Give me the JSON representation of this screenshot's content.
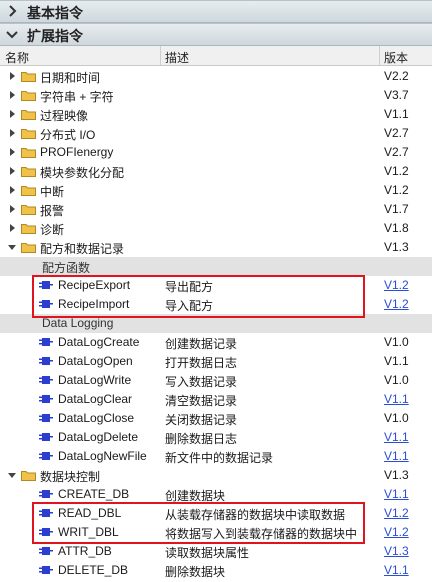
{
  "sections": {
    "basic": {
      "title": "基本指令"
    },
    "extended": {
      "title": "扩展指令"
    }
  },
  "columns": {
    "name": "名称",
    "desc": "描述",
    "version": "版本"
  },
  "folders": [
    {
      "name": "日期和时间",
      "version": "V2.2",
      "expanded": false
    },
    {
      "name": "字符串 + 字符",
      "version": "V3.7",
      "expanded": false
    },
    {
      "name": "过程映像",
      "version": "V1.1",
      "expanded": false
    },
    {
      "name": "分布式 I/O",
      "version": "V2.7",
      "expanded": false
    },
    {
      "name": "PROFIenergy",
      "version": "V2.7",
      "expanded": false
    },
    {
      "name": "模块参数化分配",
      "version": "V1.2",
      "expanded": false
    },
    {
      "name": "中断",
      "version": "V1.2",
      "expanded": false
    },
    {
      "name": "报警",
      "version": "V1.7",
      "expanded": false
    },
    {
      "name": "诊断",
      "version": "V1.8",
      "expanded": false
    },
    {
      "name": "配方和数据记录",
      "version": "V1.3",
      "expanded": true
    }
  ],
  "recipe": {
    "group_label": "配方函数",
    "items": [
      {
        "name": "RecipeExport",
        "desc": "导出配方",
        "version": "V1.2",
        "link": true
      },
      {
        "name": "RecipeImport",
        "desc": "导入配方",
        "version": "V1.2",
        "link": true
      }
    ]
  },
  "datalog": {
    "group_label": "Data Logging",
    "items": [
      {
        "name": "DataLogCreate",
        "desc": "创建数据记录",
        "version": "V1.0",
        "link": false
      },
      {
        "name": "DataLogOpen",
        "desc": "打开数据日志",
        "version": "V1.1",
        "link": false
      },
      {
        "name": "DataLogWrite",
        "desc": "写入数据记录",
        "version": "V1.0",
        "link": false
      },
      {
        "name": "DataLogClear",
        "desc": "清空数据记录",
        "version": "V1.1",
        "link": true
      },
      {
        "name": "DataLogClose",
        "desc": "关闭数据记录",
        "version": "V1.0",
        "link": false
      },
      {
        "name": "DataLogDelete",
        "desc": "删除数据日志",
        "version": "V1.1",
        "link": true
      },
      {
        "name": "DataLogNewFile",
        "desc": "新文件中的数据记录",
        "version": "V1.1",
        "link": true
      }
    ]
  },
  "datablock": {
    "name": "数据块控制",
    "version": "V1.3",
    "expanded": true,
    "items": [
      {
        "name": "CREATE_DB",
        "desc": "创建数据块",
        "version": "V1.1",
        "link": true
      },
      {
        "name": "READ_DBL",
        "desc": "从装载存储器的数据块中读取数据",
        "version": "V1.2",
        "link": true
      },
      {
        "name": "WRIT_DBL",
        "desc": "将数据写入到装载存储器的数据块中",
        "version": "V1.2",
        "link": true
      },
      {
        "name": "ATTR_DB",
        "desc": "读取数据块属性",
        "version": "V1.3",
        "link": true
      },
      {
        "name": "DELETE_DB",
        "desc": "删除数据块",
        "version": "V1.1",
        "link": true
      }
    ]
  },
  "colors": {
    "accent_link": "#2a4ed6",
    "highlight": "#e0141e",
    "folder": "#f0c24a",
    "block": "#2c3ed0"
  }
}
